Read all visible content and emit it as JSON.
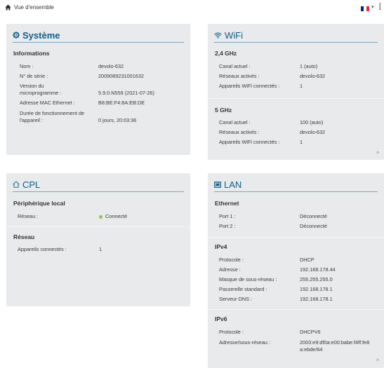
{
  "breadcrumb": {
    "label": "Vue d'ensemble",
    "icon": "home-icon"
  },
  "language": {
    "flag_colors": [
      "#002395",
      "#ffffff",
      "#ed2939"
    ],
    "caret": "▾",
    "cut_glyph": "["
  },
  "systeme": {
    "title": "Système",
    "icon": "gear-icon",
    "section": "Informations",
    "rows": [
      {
        "k": "Nom :",
        "v": "devolo-632"
      },
      {
        "k": "N° de série :",
        "v": "2009089231001632"
      },
      {
        "k1": "Version du",
        "k2": "microprogramme :",
        "v": "5.9.0.N559 (2021-07-26)"
      },
      {
        "k": "Adresse MAC Ethernet :",
        "v": "B8:BE:F4:8A:EB:DE"
      },
      {
        "k1": "Durée de fonctionnement de",
        "k2": "l'appareil :",
        "v": "0 jours, 20:03:36"
      }
    ]
  },
  "wifi": {
    "title": "WiFi",
    "icon": "wifi-icon",
    "bands": [
      {
        "name": "2,4 GHz",
        "rows": [
          {
            "k": "Canal actuel :",
            "v": "1 (auto)"
          },
          {
            "k": "Réseaux activés :",
            "v": "devolo-632"
          },
          {
            "k": "Appareils WiFi connectés :",
            "v": "1"
          }
        ]
      },
      {
        "name": "5 GHz",
        "rows": [
          {
            "k": "Canal actuel :",
            "v": "100 (auto)"
          },
          {
            "k": "Réseaux activés :",
            "v": "devolo-632"
          },
          {
            "k": "Appareils WiFi connectés :",
            "v": "1"
          }
        ]
      }
    ],
    "collapse": "^"
  },
  "cpl": {
    "title": "CPL",
    "icon": "home-outline-icon",
    "local_title": "Périphérique local",
    "local_row": {
      "k": "Réseau :",
      "v": "Connecté",
      "status_color": "#8dc63f"
    },
    "reseau_title": "Réseau",
    "reseau_row": {
      "k": "Appareils connectés :",
      "v": "1"
    }
  },
  "lan": {
    "title": "LAN",
    "icon": "lan-port-icon",
    "ethernet_title": "Ethernet",
    "ethernet": [
      {
        "k": "Port 1 :",
        "v": "Déconnecté"
      },
      {
        "k": "Port 2 :",
        "v": "Déconnecté"
      }
    ],
    "ipv4_title": "IPv4",
    "ipv4": [
      {
        "k": "Protocole :",
        "v": "DHCP"
      },
      {
        "k": "Adresse :",
        "v": "192.168.178.44"
      },
      {
        "k": "Masque de sous-réseau :",
        "v": "255.255.255.0"
      },
      {
        "k": "Passerelle standard :",
        "v": "192.168.178.1"
      },
      {
        "k": "Serveur DNS :",
        "v": "192.168.178.1"
      }
    ],
    "ipv6_title": "IPv6",
    "ipv6": [
      {
        "k": "Protocole :",
        "v": "DHCPV6"
      },
      {
        "k": "Adresse/sous-réseau :",
        "v1": "2003:e9:df0a:e00:babe:f4ff:fe8",
        "v2": "a:ebde/64"
      }
    ],
    "collapse": "^"
  }
}
